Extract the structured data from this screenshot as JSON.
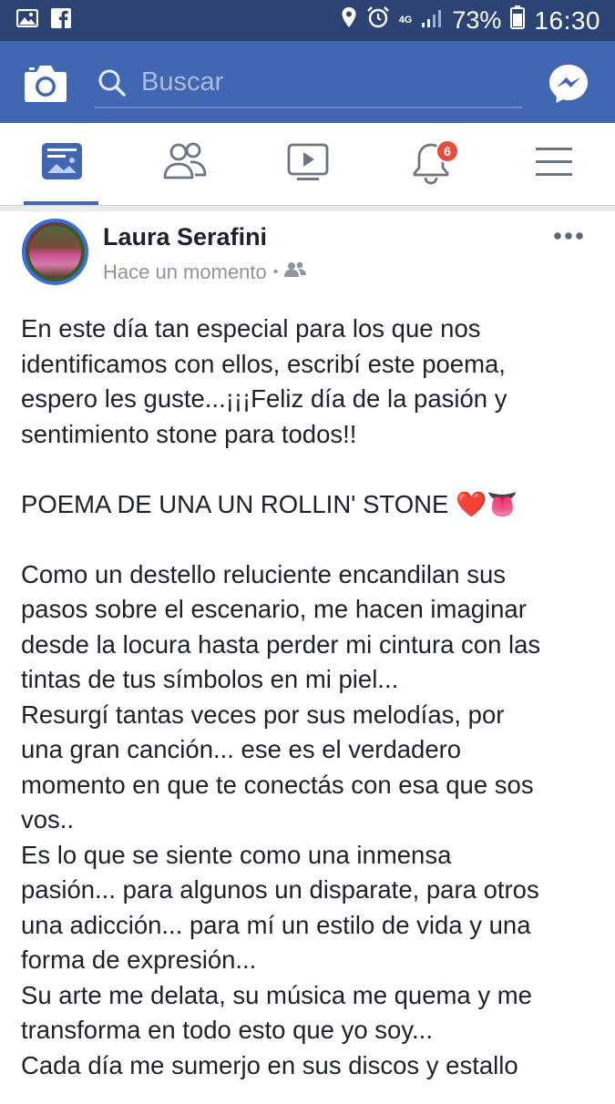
{
  "status_bar": {
    "network": "4G",
    "battery": "73%",
    "time": "16:30",
    "icons": [
      "image-icon",
      "facebook-icon",
      "location-icon",
      "alarm-icon",
      "signal-icon",
      "battery-icon"
    ]
  },
  "header": {
    "search_placeholder": "Buscar",
    "icons": [
      "camera-icon",
      "search-icon",
      "messenger-icon"
    ],
    "color": "#4267b2"
  },
  "tabs": {
    "items": [
      "news-feed-icon",
      "friends-icon",
      "watch-icon",
      "notifications-icon",
      "menu-icon"
    ],
    "notifications_badge": "6",
    "active": "news-feed"
  },
  "post": {
    "author": "Laura Serafini",
    "time": "Hace un momento",
    "separator": "•",
    "audience_icon": "friends-audience-icon",
    "lines": [
      "En este día tan especial para los que nos",
      "identificamos con ellos, escribí este poema,",
      "espero les guste...¡¡¡Feliz día de la pasión y",
      "sentimiento stone para todos!!",
      "",
      "POEMA DE UNA UN ROLLIN' STONE ❤️👅",
      "",
      "Como un destello reluciente encandilan sus",
      "pasos sobre el escenario, me hacen imaginar",
      "desde la locura hasta perder mi cintura con las",
      "tintas de tus símbolos en mi piel...",
      "Resurgí tantas veces por sus melodías, por",
      "una gran canción... ese es el verdadero",
      "momento en que te conectás con esa que sos",
      "vos..",
      "Es lo que se siente como una inmensa",
      "pasión... para algunos un disparate, para otros",
      "una adicción... para mí un estilo de vida y una",
      "forma de expresión...",
      "Su arte me delata, su música me quema y me",
      "transforma en todo esto que yo soy...",
      "Cada día me sumerjo en sus discos y estallo"
    ]
  }
}
